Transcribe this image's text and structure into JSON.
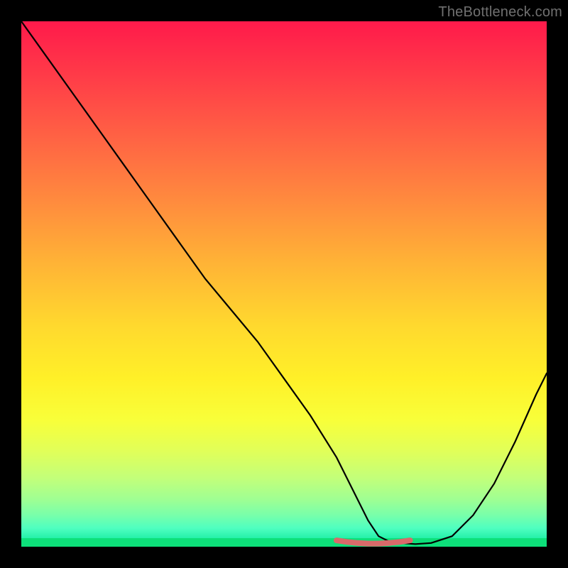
{
  "watermark": "TheBottleneck.com",
  "chart_data": {
    "type": "line",
    "title": "",
    "xlabel": "",
    "ylabel": "",
    "xlim": [
      0,
      100
    ],
    "ylim": [
      0,
      100
    ],
    "x": [
      0,
      5,
      10,
      15,
      20,
      25,
      30,
      35,
      40,
      45,
      50,
      55,
      60,
      62,
      64,
      66,
      68,
      70,
      72,
      75,
      78,
      82,
      86,
      90,
      94,
      98,
      100
    ],
    "values": [
      100,
      93,
      86,
      79,
      72,
      65,
      58,
      51,
      45,
      39,
      32,
      25,
      17,
      13,
      9,
      5,
      2,
      1,
      0.7,
      0.5,
      0.7,
      2,
      6,
      12,
      20,
      29,
      33
    ],
    "accent_segment": {
      "x": [
        60,
        62,
        64,
        66,
        68,
        70,
        72,
        74
      ],
      "values": [
        1.2,
        0.9,
        0.7,
        0.6,
        0.6,
        0.7,
        0.9,
        1.2
      ]
    },
    "colors": {
      "background_top": "#ff1a4b",
      "background_mid": "#ffd92e",
      "background_bottom": "#0de07a",
      "curve": "#000000",
      "accent": "#d96a6a"
    }
  }
}
